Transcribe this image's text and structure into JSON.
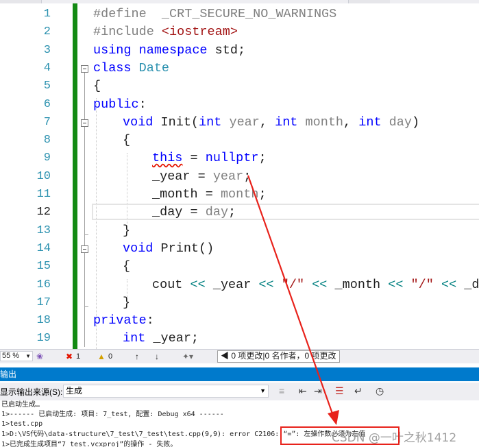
{
  "editor": {
    "line_numbers": [
      "1",
      "2",
      "3",
      "4",
      "5",
      "6",
      "7",
      "8",
      "9",
      "10",
      "11",
      "12",
      "13",
      "14",
      "15",
      "16",
      "17",
      "18",
      "19"
    ],
    "active_line": "12",
    "lines": {
      "l1": {
        "kw": "#define",
        "name": "  _CRT_SECURE_NO_WARNINGS"
      },
      "l2": {
        "kw": "#include",
        "file": " <iostream>"
      },
      "l3": {
        "a": "using",
        "b": " namespace",
        "c": " std;"
      },
      "l4": {
        "a": "class",
        "b": " Date"
      },
      "l5": {
        "a": "{"
      },
      "l6": {
        "a": "public",
        "b": ":"
      },
      "l7": {
        "a": "void",
        "b": " Init(",
        "c": "int",
        "d": " year",
        "e": ", ",
        "f": "int",
        "g": " month",
        "h": ", ",
        "i": "int",
        "j": " day",
        "k": ")"
      },
      "l8": {
        "a": "{"
      },
      "l9": {
        "a": "this",
        "b": " = ",
        "c": "nullptr",
        "d": ";"
      },
      "l10": {
        "a": "_year",
        "b": " = ",
        "c": "year",
        "d": ";"
      },
      "l11": {
        "a": "_month",
        "b": " = ",
        "c": "month",
        "d": ";"
      },
      "l12": {
        "a": "_day",
        "b": " = ",
        "c": "day",
        "d": ";"
      },
      "l13": {
        "a": "}"
      },
      "l14": {
        "a": "void",
        "b": " Print()"
      },
      "l15": {
        "a": "{"
      },
      "l16": {
        "a": "cout ",
        "b": "<<",
        "c": " _year ",
        "d": "<<",
        "e": " \"/\" ",
        "f": "<<",
        "g": " _month ",
        "h": "<<",
        "i": " \"/\" ",
        "j": "<<",
        "k": " _day"
      },
      "l17": {
        "a": "}"
      },
      "l18": {
        "a": "private",
        "b": ":"
      },
      "l19": {
        "a": "int",
        "b": " _year;"
      }
    }
  },
  "status": {
    "zoom": "55 %",
    "errors": "1",
    "warnings": "0",
    "changes": "0 项更改|0 名作者，0 项更改"
  },
  "output": {
    "title": "输出",
    "source_label": "显示输出来源(S):",
    "source_value": "生成",
    "lines": [
      "已启动生成…",
      "1>------ 已启动生成: 项目: 7_test, 配置: Debug x64 ------",
      "1>test.cpp",
      "1>D:\\VS代码\\data-structure\\7_test\\7_test\\test.cpp(9,9): error C2106: “=”: 左操作数必须为左值",
      "1>已完成生成项目“7_test.vcxproj”的操作 - 失败。"
    ]
  },
  "watermark": "CSDN @一叶之秋1412",
  "colors": {
    "accent": "#007acc",
    "change_bar": "#138a13",
    "annotation": "#e8221b"
  }
}
